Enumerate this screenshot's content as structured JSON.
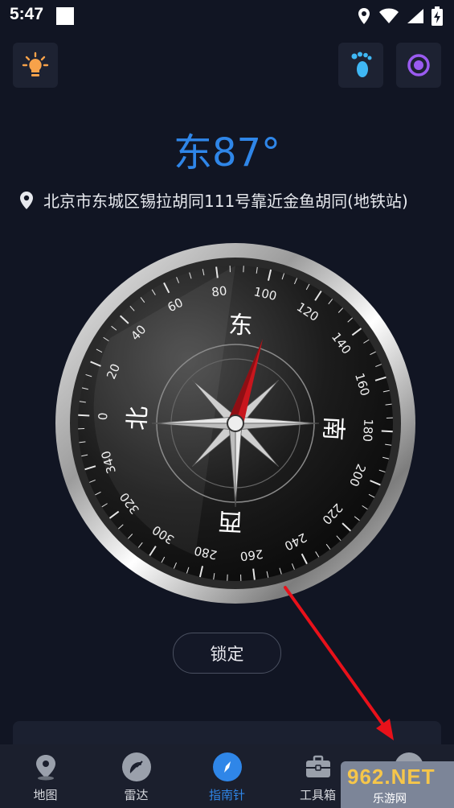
{
  "status": {
    "time": "5:47"
  },
  "heading": {
    "direction": "东87°"
  },
  "location": {
    "address": "北京市东城区锡拉胡同111号靠近金鱼胡同(地铁站)"
  },
  "compass": {
    "heading_deg": 87,
    "tick_labels": [
      "0",
      "20",
      "40",
      "60",
      "80",
      "100",
      "120",
      "140",
      "160",
      "180",
      "200",
      "220",
      "240",
      "260",
      "280",
      "300",
      "320",
      "340"
    ],
    "cardinals": {
      "north": "北",
      "east": "东",
      "south": "南",
      "west": "西"
    }
  },
  "lock": {
    "label": "锁定"
  },
  "nav": {
    "items": [
      {
        "label": "地图",
        "icon": "map-pin-icon"
      },
      {
        "label": "雷达",
        "icon": "radar-icon"
      },
      {
        "label": "指南针",
        "icon": "compass-icon"
      },
      {
        "label": "工具箱",
        "icon": "toolbox-icon"
      },
      {
        "label": "",
        "icon": "minus-icon"
      }
    ],
    "active_index": 2
  },
  "watermark": {
    "brand": "962.NET",
    "sub": "乐游网"
  },
  "colors": {
    "accent": "#2f86e8",
    "background": "#111523",
    "needle": "#b5141a",
    "annotation_arrow": "#e8111a"
  }
}
